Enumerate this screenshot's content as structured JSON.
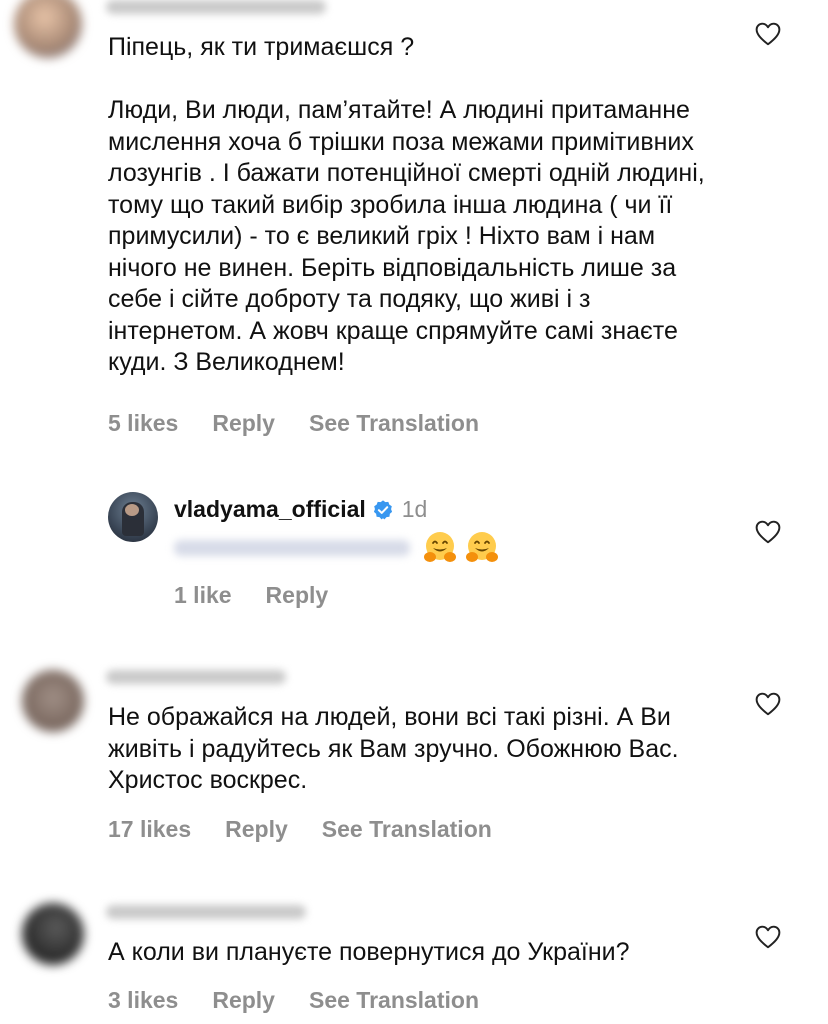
{
  "comments": [
    {
      "body": "Піпець, як ти тримаєшся ?\n\nЛюди, Ви люди, пам’ятайте! А людині притаманне мислення хоча б трішки поза межами примітивних лозунгів . І бажати потенційної смерті одній людині, тому що такий вибір зробила інша людина ( чи її примусили) - то є великий гріх ! Ніхто вам і нам нічого не винен. Беріть відповідальність лише за себе  і сійте доброту та подяку, що живі і з інтернетом. А жовч краще спрямуйте самі знаєте куди.  З Великоднем!",
      "likes": "5 likes",
      "reply": "Reply",
      "translation": "See Translation"
    },
    {
      "username": "vladyama_official",
      "time": "1d",
      "likes": "1 like",
      "reply": "Reply"
    },
    {
      "body": "Не ображайся на людей, вони всі такі різні. А Ви живіть і радуйтесь як Вам зручно. Обожнюю Вас. Христос воскрес.",
      "likes": "17 likes",
      "reply": "Reply",
      "translation": "See Translation"
    },
    {
      "body": "А коли ви плануєте повернутися до України?",
      "likes": "3 likes",
      "reply": "Reply",
      "translation": "See Translation"
    }
  ],
  "icons": {
    "heart": "heart-outline-icon",
    "verified": "verified-badge-icon",
    "emoji": "hugging-face-emoji"
  },
  "colors": {
    "meta_text": "#8e8e8e",
    "verified_blue": "#3897f0"
  }
}
